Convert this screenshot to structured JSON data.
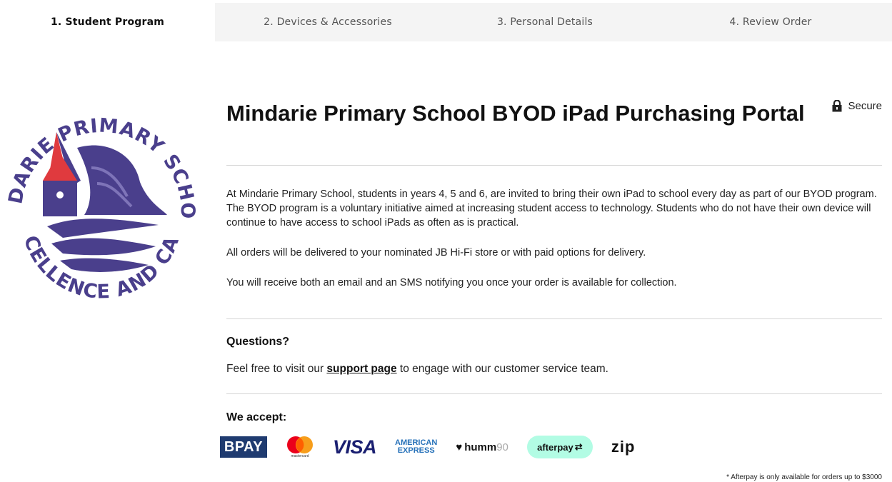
{
  "steps": [
    {
      "label": "1. Student Program",
      "active": true
    },
    {
      "label": "2. Devices & Accessories",
      "active": false
    },
    {
      "label": "3. Personal Details",
      "active": false
    },
    {
      "label": "4. Review Order",
      "active": false
    }
  ],
  "logo": {
    "top_text": "MINDARIE PRIMARY SCHOOL",
    "bottom_text": "EXCELLENCE AND CARE",
    "color": "#4a3f8c",
    "roof_color": "#e03a3e"
  },
  "header": {
    "title": "Mindarie Primary School BYOD iPad Purchasing Portal",
    "secure_label": "Secure"
  },
  "intro": {
    "p1": "At Mindarie Primary School, students in years 4, 5 and 6, are invited to bring their own iPad to school every day as part of our BYOD program. The BYOD program is a voluntary initiative aimed at increasing student access to technology. Students who do not have their own device will continue to have access to school iPads as often as is practical.",
    "p2": "All orders will be delivered to your nominated JB Hi-Fi store or with paid options for delivery.",
    "p3": "You will receive both an email and an SMS notifying you once your order is available for collection."
  },
  "questions": {
    "heading": "Questions?",
    "text_before": "Feel free to visit our ",
    "link": "support page",
    "text_after": " to engage with our customer service team."
  },
  "payments": {
    "heading": "We accept:",
    "bpay": "BPAY",
    "mastercard": "mastercard",
    "visa": "VISA",
    "amex_line1": "AMERICAN",
    "amex_line2": "EXPRESS",
    "humm": "humm",
    "humm_suffix": "90",
    "afterpay": "afterpay",
    "zip": "zip"
  },
  "footnote": "* Afterpay is only available for orders up to $3000"
}
